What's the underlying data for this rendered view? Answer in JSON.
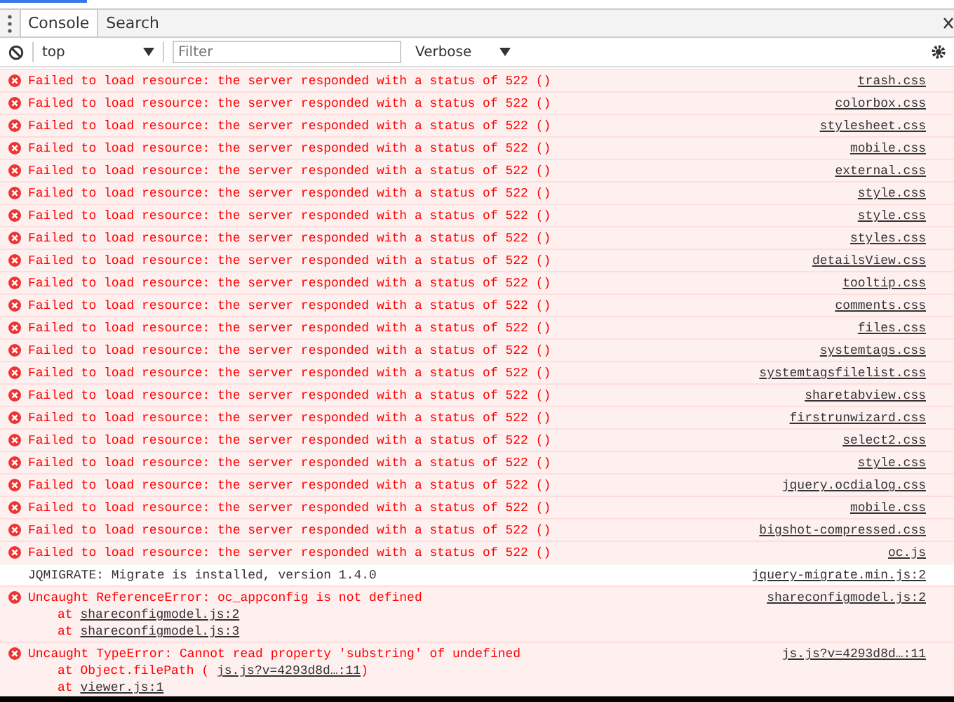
{
  "tabs": [
    {
      "label": "Console",
      "selected": true
    },
    {
      "label": "Search",
      "selected": false
    }
  ],
  "toolbar": {
    "context": "top",
    "filter_placeholder": "Filter",
    "level": "Verbose"
  },
  "messages": [
    {
      "kind": "error",
      "text": "Failed to load resource: the server responded with a status of 522 ()",
      "source": "trash.css"
    },
    {
      "kind": "error",
      "text": "Failed to load resource: the server responded with a status of 522 ()",
      "source": "colorbox.css"
    },
    {
      "kind": "error",
      "text": "Failed to load resource: the server responded with a status of 522 ()",
      "source": "stylesheet.css"
    },
    {
      "kind": "error",
      "text": "Failed to load resource: the server responded with a status of 522 ()",
      "source": "mobile.css"
    },
    {
      "kind": "error",
      "text": "Failed to load resource: the server responded with a status of 522 ()",
      "source": "external.css"
    },
    {
      "kind": "error",
      "text": "Failed to load resource: the server responded with a status of 522 ()",
      "source": "style.css"
    },
    {
      "kind": "error",
      "text": "Failed to load resource: the server responded with a status of 522 ()",
      "source": "style.css"
    },
    {
      "kind": "error",
      "text": "Failed to load resource: the server responded with a status of 522 ()",
      "source": "styles.css"
    },
    {
      "kind": "error",
      "text": "Failed to load resource: the server responded with a status of 522 ()",
      "source": "detailsView.css"
    },
    {
      "kind": "error",
      "text": "Failed to load resource: the server responded with a status of 522 ()",
      "source": "tooltip.css"
    },
    {
      "kind": "error",
      "text": "Failed to load resource: the server responded with a status of 522 ()",
      "source": "comments.css"
    },
    {
      "kind": "error",
      "text": "Failed to load resource: the server responded with a status of 522 ()",
      "source": "files.css"
    },
    {
      "kind": "error",
      "text": "Failed to load resource: the server responded with a status of 522 ()",
      "source": "systemtags.css"
    },
    {
      "kind": "error",
      "text": "Failed to load resource: the server responded with a status of 522 ()",
      "source": "systemtagsfilelist.css"
    },
    {
      "kind": "error",
      "text": "Failed to load resource: the server responded with a status of 522 ()",
      "source": "sharetabview.css"
    },
    {
      "kind": "error",
      "text": "Failed to load resource: the server responded with a status of 522 ()",
      "source": "firstrunwizard.css"
    },
    {
      "kind": "error",
      "text": "Failed to load resource: the server responded with a status of 522 ()",
      "source": "select2.css"
    },
    {
      "kind": "error",
      "text": "Failed to load resource: the server responded with a status of 522 ()",
      "source": "style.css"
    },
    {
      "kind": "error",
      "text": "Failed to load resource: the server responded with a status of 522 ()",
      "source": "jquery.ocdialog.css"
    },
    {
      "kind": "error",
      "text": "Failed to load resource: the server responded with a status of 522 ()",
      "source": "mobile.css"
    },
    {
      "kind": "error",
      "text": "Failed to load resource: the server responded with a status of 522 ()",
      "source": "bigshot-compressed.css"
    },
    {
      "kind": "error",
      "text": "Failed to load resource: the server responded with a status of 522 ()",
      "source": "oc.js"
    },
    {
      "kind": "info",
      "text": "JQMIGRATE: Migrate is installed, version 1.4.0",
      "source": "jquery-migrate.min.js:2"
    },
    {
      "kind": "error",
      "text": "Uncaught ReferenceError: oc_appconfig is not defined",
      "source": "shareconfigmodel.js:2",
      "stack": [
        {
          "prefix": "at",
          "link": "shareconfigmodel.js:2"
        },
        {
          "prefix": "at",
          "link": "shareconfigmodel.js:3"
        }
      ]
    },
    {
      "kind": "error",
      "text": "Uncaught TypeError: Cannot read property 'substring' of undefined",
      "source": "js.js?v=4293d8d…:11",
      "stack": [
        {
          "prefix": "at Object.filePath (",
          "link": "js.js?v=4293d8d…:11",
          "suffix": ")"
        },
        {
          "prefix": "at",
          "link": "viewer.js:1"
        }
      ]
    }
  ]
}
